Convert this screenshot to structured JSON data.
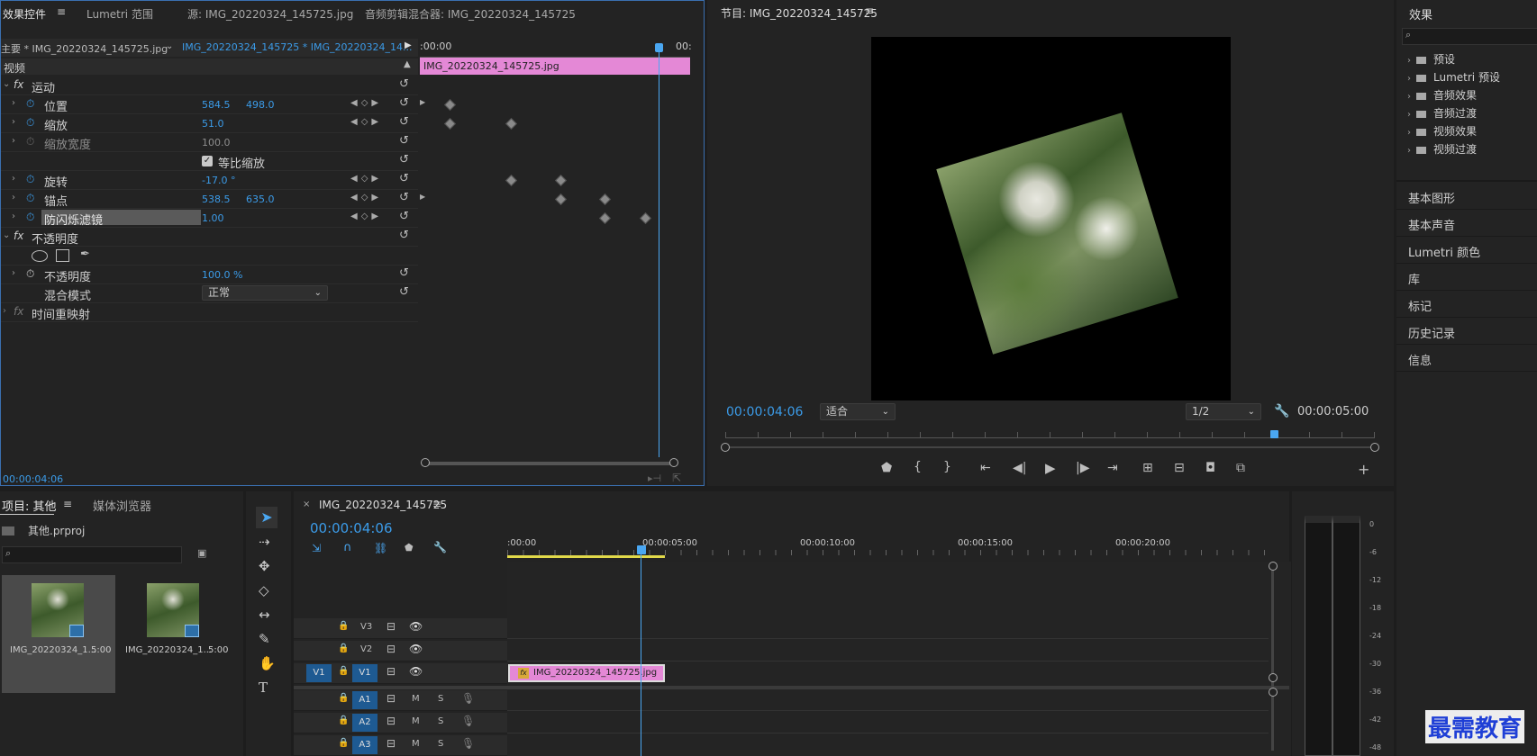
{
  "effect_controls": {
    "tabs": [
      "效果控件",
      "Lumetri 范围",
      "源: IMG_20220324_145725.jpg",
      "音频剪辑混合器: IMG_20220324_145725"
    ],
    "master_label": "主要 * IMG_20220324_145725.jpg",
    "sequence_label": "IMG_20220324_145725 * IMG_20220324_14...",
    "time_start": ":00:00",
    "time_end": "00:",
    "clip_name": "IMG_20220324_145725.jpg",
    "video_header": "视频",
    "motion_label": "运动",
    "position_label": "位置",
    "position_x": "584.5",
    "position_y": "498.0",
    "scale_label": "缩放",
    "scale_value": "51.0",
    "scale_width_label": "缩放宽度",
    "scale_width_value": "100.0",
    "uniform_scale_label": "等比缩放",
    "rotation_label": "旋转",
    "rotation_value": "-17.0 °",
    "anchor_label": "锚点",
    "anchor_x": "538.5",
    "anchor_y": "635.0",
    "antiflicker_label": "防闪烁滤镜",
    "antiflicker_value": "1.00",
    "opacity_section_label": "不透明度",
    "opacity_label": "不透明度",
    "opacity_value": "100.0 %",
    "blend_label": "混合模式",
    "blend_value": "正常",
    "time_remap_label": "时间重映射",
    "current_time": "00:00:04:06"
  },
  "program_monitor": {
    "title": "节目: IMG_20220324_145725",
    "timecode": "00:00:04:06",
    "fit_value": "适合",
    "resolution_value": "1/2",
    "duration": "00:00:05:00"
  },
  "effects_panel": {
    "title": "效果",
    "tree": [
      "预设",
      "Lumetri 预设",
      "音频效果",
      "音频过渡",
      "视频效果",
      "视频过渡"
    ],
    "panels": [
      "基本图形",
      "基本声音",
      "Lumetri 颜色",
      "库",
      "标记",
      "历史记录",
      "信息"
    ]
  },
  "project": {
    "tabs": [
      "项目: 其他",
      "媒体浏览器"
    ],
    "file_name": "其他.prproj",
    "items": [
      {
        "name": "IMG_20220324_1...",
        "duration": "5:00"
      },
      {
        "name": "IMG_20220324_1...",
        "duration": "5:00"
      }
    ]
  },
  "timeline": {
    "tab_title": "IMG_20220324_145725",
    "timecode": "00:00:04:06",
    "ruler_labels": [
      ":00:00",
      "00:00:05:00",
      "00:00:10:00",
      "00:00:15:00",
      "00:00:20:00"
    ],
    "video_tracks": [
      "V3",
      "V2",
      "V1"
    ],
    "source_patch": "V1",
    "audio_tracks": [
      "A1",
      "A2",
      "A3"
    ],
    "track_m": "M",
    "track_s": "S",
    "clip_name": "IMG_20220324_145725.jpg",
    "fx_badge": "fx"
  },
  "meter": {
    "scale": [
      "0",
      "-6",
      "-12",
      "-18",
      "-24",
      "-30",
      "-36",
      "-42",
      "-48"
    ]
  },
  "watermark": "最需教育",
  "colors": {
    "accent_blue": "#3b9be8",
    "clip_pink": "#e488d6",
    "playhead_blue": "#4aa7f2",
    "work_area_yellow": "#e1d94a"
  }
}
